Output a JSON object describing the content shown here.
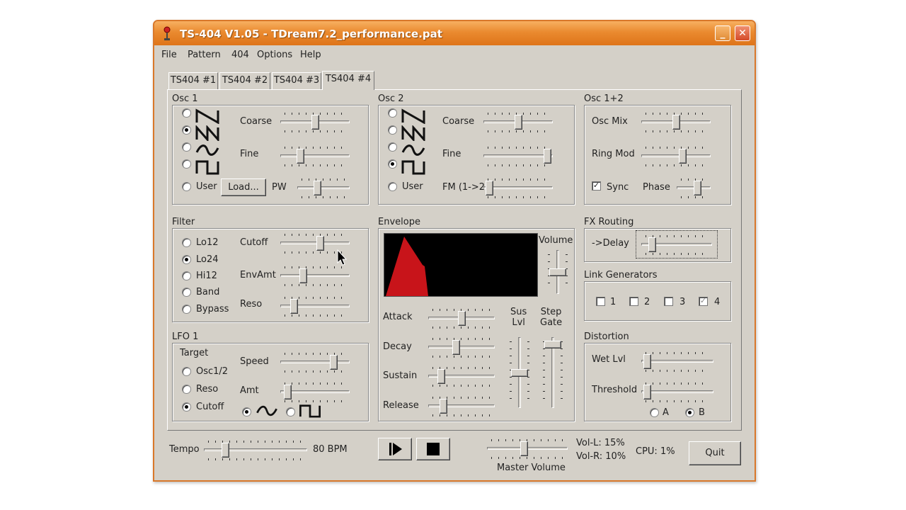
{
  "window": {
    "title": "TS-404 V1.05 - TDream7.2_performance.pat",
    "minimize_label": "_",
    "close_label": "✕",
    "accent": "#e8852c"
  },
  "menu": [
    "File",
    "Pattern",
    "404",
    "Options",
    "Help"
  ],
  "tabs": [
    "TS404 #1",
    "TS404 #2",
    "TS404 #3",
    "TS404 #4"
  ],
  "active_tab": "TS404 #4",
  "osc1": {
    "title": "Osc 1",
    "waveforms": [
      "saw",
      "triangle-saw",
      "sine",
      "square"
    ],
    "user_label": "User",
    "load_label": "Load...",
    "coarse_label": "Coarse",
    "fine_label": "Fine",
    "pw_label": "PW",
    "coarse": 0.5,
    "fine": 0.25,
    "pw": 0.35
  },
  "osc2": {
    "title": "Osc 2",
    "user_label": "User",
    "coarse_label": "Coarse",
    "fine_label": "Fine",
    "fm_label": "FM (1->2)",
    "coarse": 0.5,
    "fine": 0.98,
    "fm": 0.02
  },
  "osc12": {
    "title": "Osc 1+2",
    "oscmix_label": "Osc Mix",
    "ringmod_label": "Ring Mod",
    "sync_label": "Sync",
    "phase_label": "Phase",
    "oscmix": 0.5,
    "ringmod": 0.6,
    "phase": 0.65
  },
  "filter": {
    "title": "Filter",
    "types": [
      "Lo12",
      "Lo24",
      "Hi12",
      "Band",
      "Bypass"
    ],
    "selected": "Lo24",
    "cutoff_label": "Cutoff",
    "envamt_label": "EnvAmt",
    "reso_label": "Reso",
    "cutoff": 0.58,
    "envamt": 0.3,
    "reso": 0.15
  },
  "lfo1": {
    "title": "LFO 1",
    "target_label": "Target",
    "targets": [
      "Osc1/2",
      "Reso",
      "Cutoff"
    ],
    "selected": "Cutoff",
    "speed_label": "Speed",
    "amt_label": "Amt",
    "speed": 0.8,
    "amt": 0.05
  },
  "envelope": {
    "title": "Envelope",
    "volume_label": "Volume",
    "attack_label": "Attack",
    "decay_label": "Decay",
    "sustain_label": "Sustain",
    "release_label": "Release",
    "suslvl_label": "Sus\nLvl",
    "stepgate_label": "Step\nGate",
    "attack": 0.5,
    "decay": 0.4,
    "sustain": 0.15,
    "release": 0.18,
    "volume": 0.5,
    "suslvl": 0.5,
    "stepgate": 0.95
  },
  "fxrouting": {
    "title": "FX Routing",
    "delay_label": "->Delay",
    "delay": 0.1
  },
  "link": {
    "title": "Link Generators",
    "items": [
      "1",
      "2",
      "3",
      "4"
    ]
  },
  "distortion": {
    "title": "Distortion",
    "wetlvl_label": "Wet Lvl",
    "threshold_label": "Threshold",
    "mode_a": "A",
    "mode_b": "B",
    "wetlvl": 0.02,
    "threshold": 0.02
  },
  "bottom": {
    "tempo_label": "Tempo",
    "bpm": "80 BPM",
    "tempo": 0.18,
    "master_label": "Master Volume",
    "master": 0.45,
    "vol_l": "Vol-L: 15%",
    "vol_r": "Vol-R: 10%",
    "cpu": "CPU: 1%",
    "quit_label": "Quit"
  }
}
